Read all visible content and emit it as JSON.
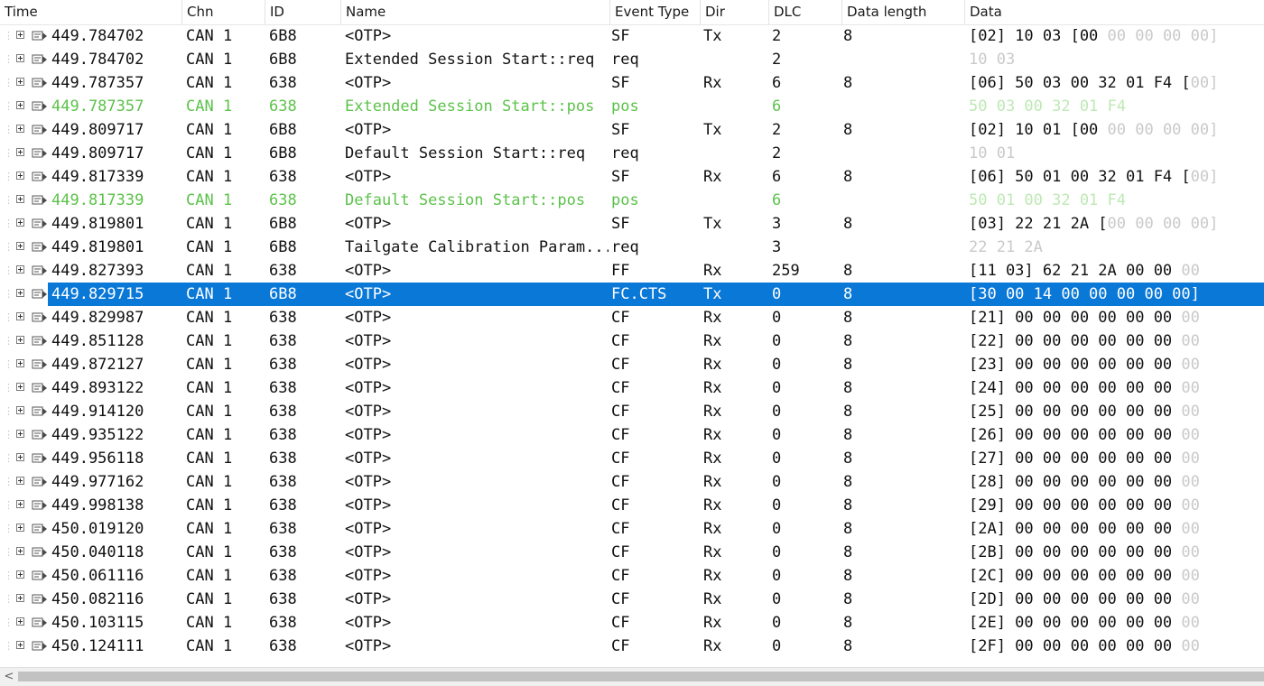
{
  "columns": {
    "time": "Time",
    "chn": "Chn",
    "id": "ID",
    "name": "Name",
    "event_type": "Event Type",
    "dir": "Dir",
    "dlc": "DLC",
    "data_length": "Data length",
    "data": "Data"
  },
  "colors": {
    "selection": "#0a78d7",
    "highlight_text": "#5cc24a",
    "dim_text": "#c9c9c9"
  },
  "rows": [
    {
      "time": "449.784702",
      "chn": "CAN 1",
      "id": "6B8",
      "name": "<OTP>",
      "event_type": "SF",
      "dir": "Tx",
      "dlc": "2",
      "data_length": "8",
      "data": "[02] 10 03 [00",
      "data_dim": " 00 00 00 00]"
    },
    {
      "time": "449.784702",
      "chn": "CAN 1",
      "id": "6B8",
      "name": "Extended Session Start::req",
      "event_type": "req",
      "dir": "",
      "dlc": "2",
      "data_length": "",
      "data": "",
      "data_dim": "10 03"
    },
    {
      "time": "449.787357",
      "chn": "CAN 1",
      "id": "638",
      "name": "<OTP>",
      "event_type": "SF",
      "dir": "Rx",
      "dlc": "6",
      "data_length": "8",
      "data": "[06] 50 03 00 32 01 F4 [",
      "data_dim": "00]"
    },
    {
      "time": "449.787357",
      "chn": "CAN 1",
      "id": "638",
      "name": "Extended Session Start::pos",
      "event_type": "pos",
      "dir": "",
      "dlc": "6",
      "data_length": "",
      "data": "50 03 00 32 01 F4",
      "data_dim": "",
      "highlight": true
    },
    {
      "time": "449.809717",
      "chn": "CAN 1",
      "id": "6B8",
      "name": "<OTP>",
      "event_type": "SF",
      "dir": "Tx",
      "dlc": "2",
      "data_length": "8",
      "data": "[02] 10 01 [00",
      "data_dim": " 00 00 00 00]"
    },
    {
      "time": "449.809717",
      "chn": "CAN 1",
      "id": "6B8",
      "name": "Default Session Start::req",
      "event_type": "req",
      "dir": "",
      "dlc": "2",
      "data_length": "",
      "data": "",
      "data_dim": "10 01"
    },
    {
      "time": "449.817339",
      "chn": "CAN 1",
      "id": "638",
      "name": "<OTP>",
      "event_type": "SF",
      "dir": "Rx",
      "dlc": "6",
      "data_length": "8",
      "data": "[06] 50 01 00 32 01 F4 [",
      "data_dim": "00]"
    },
    {
      "time": "449.817339",
      "chn": "CAN 1",
      "id": "638",
      "name": "Default Session Start::pos",
      "event_type": "pos",
      "dir": "",
      "dlc": "6",
      "data_length": "",
      "data": "50 01 00 32 01 F4",
      "data_dim": "",
      "highlight": true
    },
    {
      "time": "449.819801",
      "chn": "CAN 1",
      "id": "6B8",
      "name": "<OTP>",
      "event_type": "SF",
      "dir": "Tx",
      "dlc": "3",
      "data_length": "8",
      "data": "[03] 22 21 2A [",
      "data_dim": "00 00 00 00]"
    },
    {
      "time": "449.819801",
      "chn": "CAN 1",
      "id": "6B8",
      "name": "Tailgate Calibration Param...",
      "event_type": "req",
      "dir": "",
      "dlc": "3",
      "data_length": "",
      "data": "",
      "data_dim": "22 21 2A"
    },
    {
      "time": "449.827393",
      "chn": "CAN 1",
      "id": "638",
      "name": "<OTP>",
      "event_type": "FF",
      "dir": "Rx",
      "dlc": "259",
      "data_length": "8",
      "data": "[11 03] 62 21 2A 00 00",
      "data_dim": " 00"
    },
    {
      "time": "449.829715",
      "chn": "CAN 1",
      "id": "6B8",
      "name": "<OTP>",
      "event_type": "FC.CTS",
      "dir": "Tx",
      "dlc": "0",
      "data_length": "8",
      "data": "[30 00 14 00 00 00 00 00]",
      "data_dim": "",
      "selected": true
    },
    {
      "time": "449.829987",
      "chn": "CAN 1",
      "id": "638",
      "name": "<OTP>",
      "event_type": "CF",
      "dir": "Rx",
      "dlc": "0",
      "data_length": "8",
      "data": "[21] 00 00 00 00 00 00",
      "data_dim": " 00"
    },
    {
      "time": "449.851128",
      "chn": "CAN 1",
      "id": "638",
      "name": "<OTP>",
      "event_type": "CF",
      "dir": "Rx",
      "dlc": "0",
      "data_length": "8",
      "data": "[22] 00 00 00 00 00 00",
      "data_dim": " 00"
    },
    {
      "time": "449.872127",
      "chn": "CAN 1",
      "id": "638",
      "name": "<OTP>",
      "event_type": "CF",
      "dir": "Rx",
      "dlc": "0",
      "data_length": "8",
      "data": "[23] 00 00 00 00 00 00",
      "data_dim": " 00"
    },
    {
      "time": "449.893122",
      "chn": "CAN 1",
      "id": "638",
      "name": "<OTP>",
      "event_type": "CF",
      "dir": "Rx",
      "dlc": "0",
      "data_length": "8",
      "data": "[24] 00 00 00 00 00 00",
      "data_dim": " 00"
    },
    {
      "time": "449.914120",
      "chn": "CAN 1",
      "id": "638",
      "name": "<OTP>",
      "event_type": "CF",
      "dir": "Rx",
      "dlc": "0",
      "data_length": "8",
      "data": "[25] 00 00 00 00 00 00",
      "data_dim": " 00"
    },
    {
      "time": "449.935122",
      "chn": "CAN 1",
      "id": "638",
      "name": "<OTP>",
      "event_type": "CF",
      "dir": "Rx",
      "dlc": "0",
      "data_length": "8",
      "data": "[26] 00 00 00 00 00 00",
      "data_dim": " 00"
    },
    {
      "time": "449.956118",
      "chn": "CAN 1",
      "id": "638",
      "name": "<OTP>",
      "event_type": "CF",
      "dir": "Rx",
      "dlc": "0",
      "data_length": "8",
      "data": "[27] 00 00 00 00 00 00",
      "data_dim": " 00"
    },
    {
      "time": "449.977162",
      "chn": "CAN 1",
      "id": "638",
      "name": "<OTP>",
      "event_type": "CF",
      "dir": "Rx",
      "dlc": "0",
      "data_length": "8",
      "data": "[28] 00 00 00 00 00 00",
      "data_dim": " 00"
    },
    {
      "time": "449.998138",
      "chn": "CAN 1",
      "id": "638",
      "name": "<OTP>",
      "event_type": "CF",
      "dir": "Rx",
      "dlc": "0",
      "data_length": "8",
      "data": "[29] 00 00 00 00 00 00",
      "data_dim": " 00"
    },
    {
      "time": "450.019120",
      "chn": "CAN 1",
      "id": "638",
      "name": "<OTP>",
      "event_type": "CF",
      "dir": "Rx",
      "dlc": "0",
      "data_length": "8",
      "data": "[2A] 00 00 00 00 00 00",
      "data_dim": " 00"
    },
    {
      "time": "450.040118",
      "chn": "CAN 1",
      "id": "638",
      "name": "<OTP>",
      "event_type": "CF",
      "dir": "Rx",
      "dlc": "0",
      "data_length": "8",
      "data": "[2B] 00 00 00 00 00 00",
      "data_dim": " 00"
    },
    {
      "time": "450.061116",
      "chn": "CAN 1",
      "id": "638",
      "name": "<OTP>",
      "event_type": "CF",
      "dir": "Rx",
      "dlc": "0",
      "data_length": "8",
      "data": "[2C] 00 00 00 00 00 00",
      "data_dim": " 00"
    },
    {
      "time": "450.082116",
      "chn": "CAN 1",
      "id": "638",
      "name": "<OTP>",
      "event_type": "CF",
      "dir": "Rx",
      "dlc": "0",
      "data_length": "8",
      "data": "[2D] 00 00 00 00 00 00",
      "data_dim": " 00"
    },
    {
      "time": "450.103115",
      "chn": "CAN 1",
      "id": "638",
      "name": "<OTP>",
      "event_type": "CF",
      "dir": "Rx",
      "dlc": "0",
      "data_length": "8",
      "data": "[2E] 00 00 00 00 00 00",
      "data_dim": " 00"
    },
    {
      "time": "450.124111",
      "chn": "CAN 1",
      "id": "638",
      "name": "<OTP>",
      "event_type": "CF",
      "dir": "Rx",
      "dlc": "0",
      "data_length": "8",
      "data": "[2F] 00 00 00 00 00 00",
      "data_dim": " 00"
    }
  ],
  "scrollbar": {
    "left_arrow": "<"
  }
}
